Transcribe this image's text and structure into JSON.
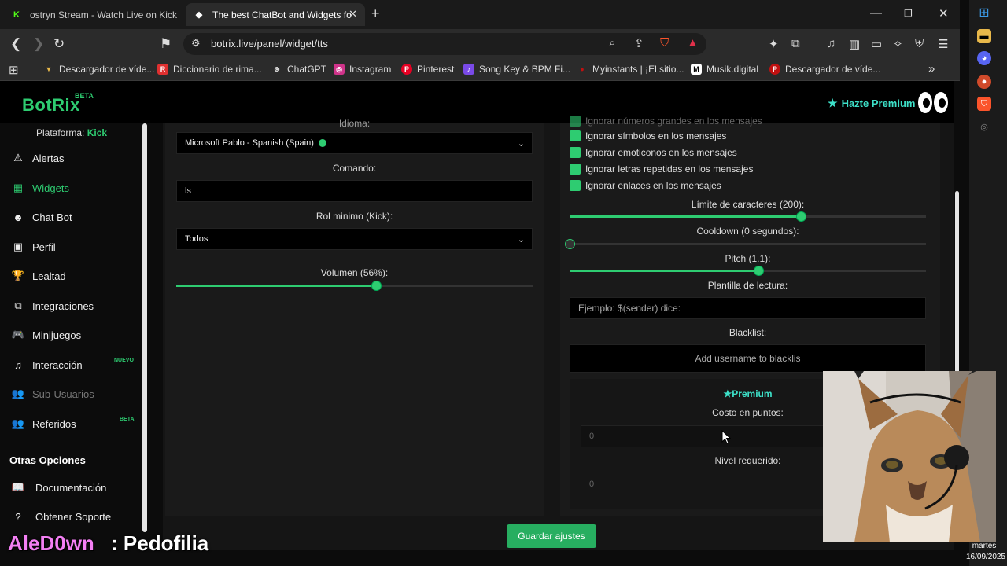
{
  "browser": {
    "tabs": [
      {
        "title": "ostryn Stream - Watch Live on Kick",
        "favicon": "K"
      },
      {
        "title": "The best ChatBot and Widgets fo",
        "favicon": "◆"
      }
    ],
    "url": "botrix.live/panel/widget/tts",
    "bookmarks": [
      {
        "label": "Descargador de víde...",
        "icon": "▼",
        "color": "#e8b84a"
      },
      {
        "label": "Diccionario de rima...",
        "icon": "R",
        "color": "#e03030"
      },
      {
        "label": "ChatGPT",
        "icon": "⊛",
        "color": "#555555"
      },
      {
        "label": "Instagram",
        "icon": "◎",
        "color": "#d0338a"
      },
      {
        "label": "Pinterest",
        "icon": "P",
        "color": "#e60023"
      },
      {
        "label": "Song Key & BPM Fi...",
        "icon": "♪",
        "color": "#7a4ae8"
      },
      {
        "label": "Myinstants | ¡El sitio...",
        "icon": "●",
        "color": "#c01010"
      },
      {
        "label": "Musik.digital",
        "icon": "M",
        "color": "#ffffff"
      },
      {
        "label": "Descargador de víde...",
        "icon": "P",
        "color": "#c01010"
      }
    ]
  },
  "site": {
    "logo": "BotRix",
    "beta": "BETA",
    "premium_label": "Hazte Premium"
  },
  "sidebar": {
    "platform_label": "Plataforma:",
    "platform_value": "Kick",
    "items": [
      {
        "label": "Alertas",
        "icon": "⚠"
      },
      {
        "label": "Widgets",
        "icon": "▦"
      },
      {
        "label": "Chat Bot",
        "icon": "☻"
      },
      {
        "label": "Perfil",
        "icon": "▣"
      },
      {
        "label": "Lealtad",
        "icon": "🏆"
      },
      {
        "label": "Integraciones",
        "icon": "⧉"
      },
      {
        "label": "Minijuegos",
        "icon": "🎮"
      },
      {
        "label": "Interacción",
        "icon": "♫"
      },
      {
        "label": "Sub-Usuarios",
        "icon": "👥"
      },
      {
        "label": "Referidos",
        "icon": "👥"
      }
    ],
    "badge_new": "NUEVO",
    "badge_beta": "BETA",
    "other_heading": "Otras Opciones",
    "other_items": [
      {
        "label": "Documentación",
        "icon": "📖"
      },
      {
        "label": "Obtener Soporte",
        "icon": "?"
      }
    ]
  },
  "form": {
    "idioma_label": "Idioma:",
    "voice_value": "Microsoft Pablo - Spanish (Spain)",
    "command_label": "Comando:",
    "command_value": "ls",
    "role_label": "Rol minimo (Kick):",
    "role_value": "Todos",
    "volume_label": "Volumen (56%):",
    "volume_value": 0.56
  },
  "settings": {
    "checkboxes": [
      "Ignorar números grandes en los mensajes",
      "Ignorar símbolos en los mensajes",
      "Ignorar emoticonos en los mensajes",
      "Ignorar letras repetidas en los mensajes",
      "Ignorar enlaces en los mensajes"
    ],
    "char_limit_label": "Límite de caracteres (200):",
    "char_limit_value": 0.65,
    "cooldown_label": "Cooldown (0 segundos):",
    "cooldown_value": 0,
    "pitch_label": "Pitch (1.1):",
    "pitch_value": 0.53,
    "template_label": "Plantilla de lectura:",
    "template_placeholder": "Ejemplo: $(sender) dice:",
    "blacklist_label": "Blacklist:",
    "blacklist_placeholder": "Add username to blacklis",
    "premium_title": "Premium",
    "cost_label": "Costo en puntos:",
    "cost_value": "0",
    "level_label": "Nivel requerido:",
    "level_value": "0"
  },
  "save_button": "Guardar ajustes",
  "overlay": {
    "username": "AleD0wn",
    "separator": ":",
    "message": "Pedofilia"
  },
  "clock": {
    "day": "martes",
    "date": "16/09/2025"
  },
  "colors": {
    "accent": "#2ecc71",
    "premium": "#3de0c8",
    "overlay_user": "#f37ff3"
  }
}
